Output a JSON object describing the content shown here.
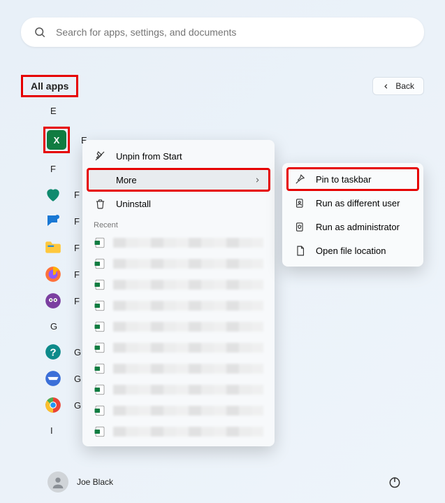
{
  "search": {
    "placeholder": "Search for apps, settings, and documents"
  },
  "header": {
    "allApps": "All apps",
    "back": "Back"
  },
  "letters": {
    "E": "E",
    "F": "F",
    "G": "G",
    "I": "I"
  },
  "apps": {
    "excel": "E",
    "f1": "F",
    "f2": "F",
    "f3": "F",
    "f4": "F",
    "f5": "F",
    "g1": "G",
    "g2": "G",
    "g3": "G"
  },
  "context": {
    "unpin": "Unpin from Start",
    "more": "More",
    "uninstall": "Uninstall",
    "recent": "Recent"
  },
  "submenu": {
    "pinTaskbar": "Pin to taskbar",
    "runDifferent": "Run as different user",
    "runAdmin": "Run as administrator",
    "openLocation": "Open file location"
  },
  "footer": {
    "user": "Joe Black"
  }
}
